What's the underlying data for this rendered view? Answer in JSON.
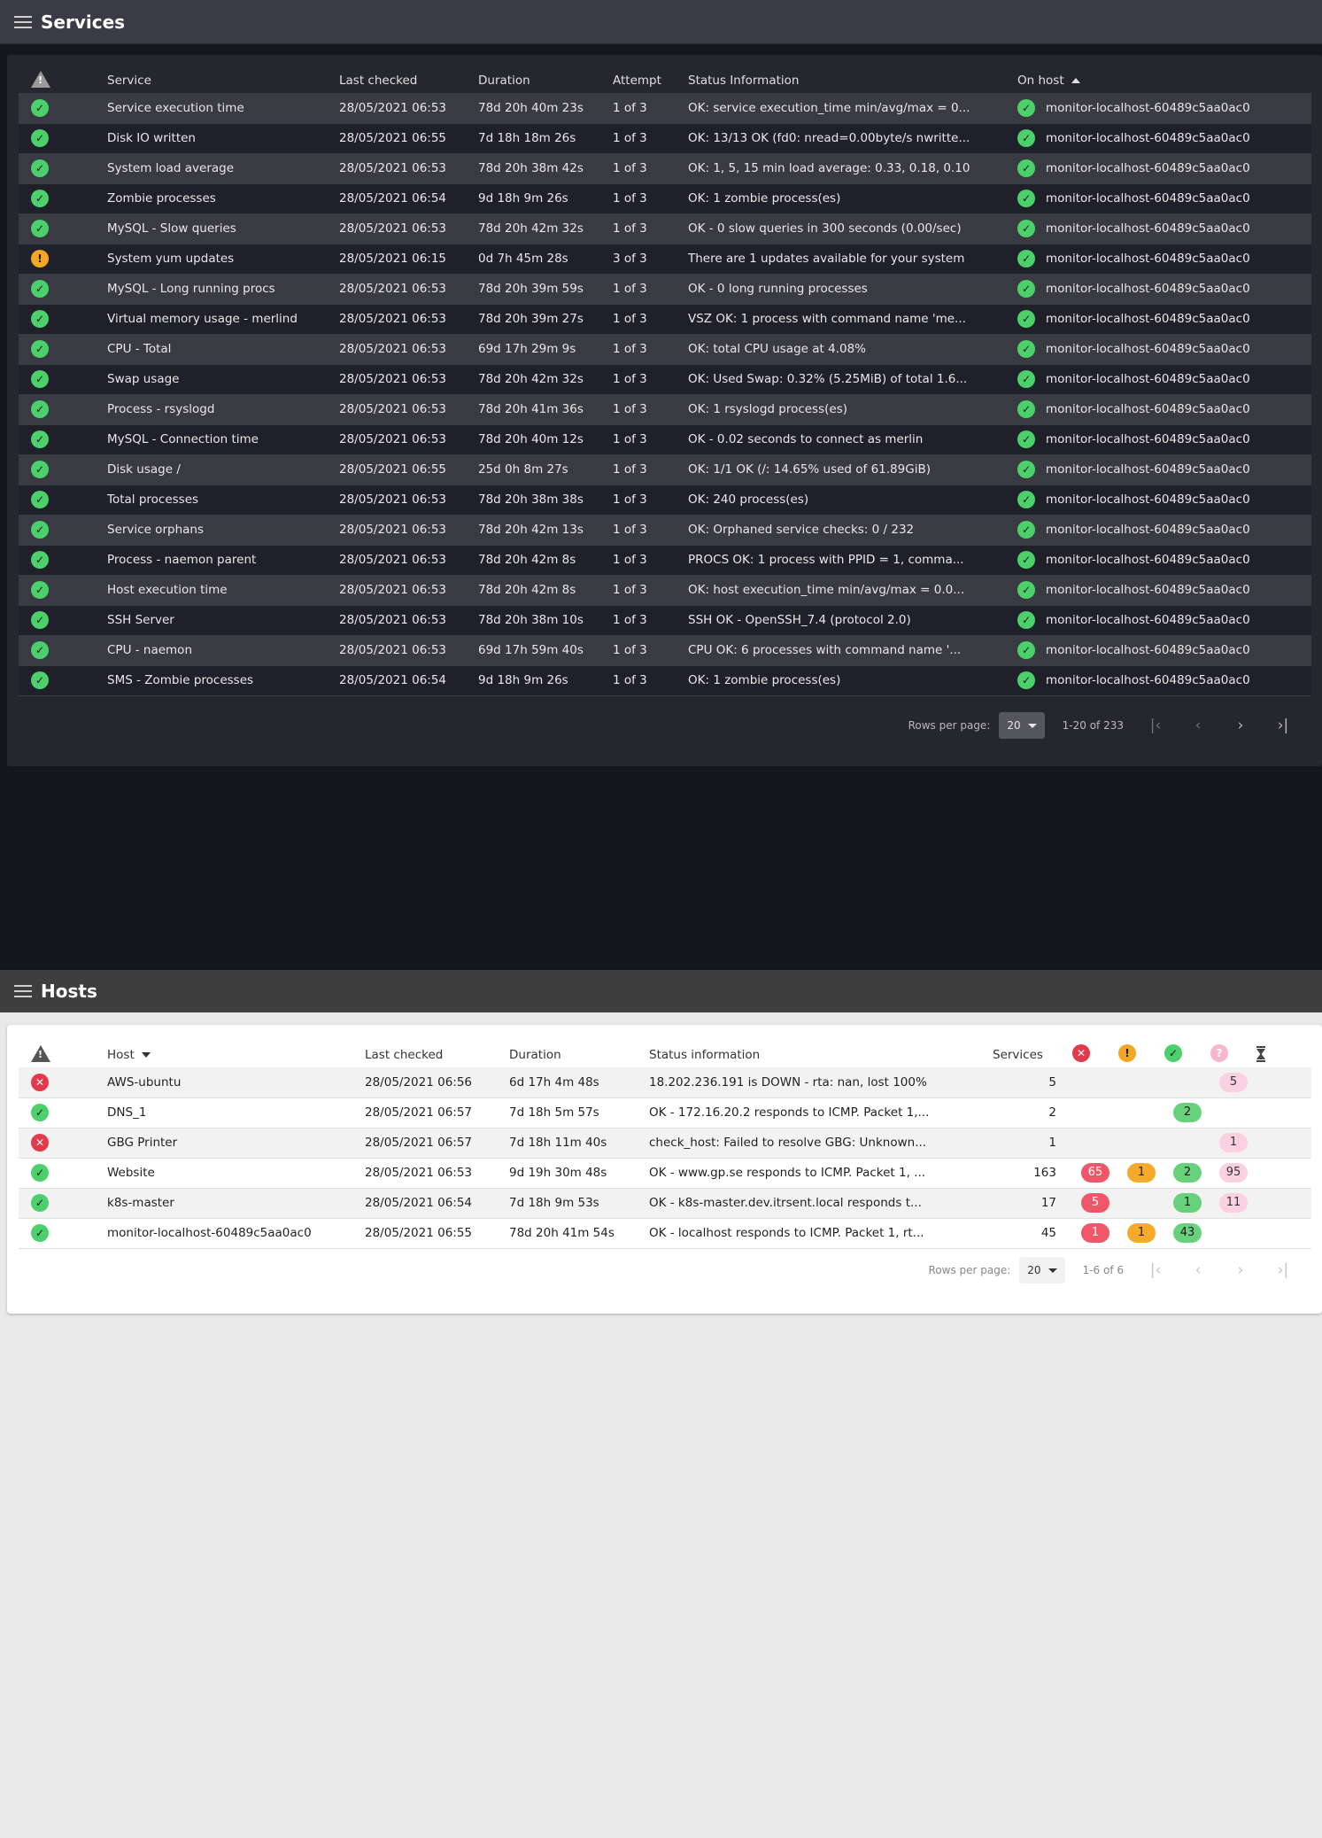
{
  "services": {
    "title": "Services",
    "columns": {
      "service": "Service",
      "last_checked": "Last checked",
      "duration": "Duration",
      "attempt": "Attempt",
      "status_info": "Status Information",
      "on_host": "On host"
    },
    "rows": [
      {
        "state": "ok",
        "service": "Service execution time",
        "last_checked": "28/05/2021 06:53",
        "duration": "78d 20h 40m 23s",
        "attempt": "1 of 3",
        "info": "OK: service execution_time min/avg/max = 0...",
        "host": "monitor-localhost-60489c5aa0ac0"
      },
      {
        "state": "ok",
        "service": "Disk IO written",
        "last_checked": "28/05/2021 06:55",
        "duration": "7d 18h 18m 26s",
        "attempt": "1 of 3",
        "info": "OK: 13/13 OK (fd0: nread=0.00byte/s nwritte...",
        "host": "monitor-localhost-60489c5aa0ac0"
      },
      {
        "state": "ok",
        "service": "System load average",
        "last_checked": "28/05/2021 06:53",
        "duration": "78d 20h 38m 42s",
        "attempt": "1 of 3",
        "info": "OK: 1, 5, 15 min load average: 0.33, 0.18, 0.10",
        "host": "monitor-localhost-60489c5aa0ac0"
      },
      {
        "state": "ok",
        "service": "Zombie processes",
        "last_checked": "28/05/2021 06:54",
        "duration": "9d 18h 9m 26s",
        "attempt": "1 of 3",
        "info": "OK: 1 zombie process(es)",
        "host": "monitor-localhost-60489c5aa0ac0"
      },
      {
        "state": "ok",
        "service": "MySQL - Slow queries",
        "last_checked": "28/05/2021 06:53",
        "duration": "78d 20h 42m 32s",
        "attempt": "1 of 3",
        "info": "OK - 0 slow queries in 300 seconds (0.00/sec)",
        "host": "monitor-localhost-60489c5aa0ac0"
      },
      {
        "state": "warn",
        "service": "System yum updates",
        "last_checked": "28/05/2021 06:15",
        "duration": "0d 7h 45m 28s",
        "attempt": "3 of 3",
        "info": "There are 1 updates available for your system",
        "host": "monitor-localhost-60489c5aa0ac0"
      },
      {
        "state": "ok",
        "service": "MySQL - Long running procs",
        "last_checked": "28/05/2021 06:53",
        "duration": "78d 20h 39m 59s",
        "attempt": "1 of 3",
        "info": "OK - 0 long running processes",
        "host": "monitor-localhost-60489c5aa0ac0"
      },
      {
        "state": "ok",
        "service": "Virtual memory usage - merlind",
        "last_checked": "28/05/2021 06:53",
        "duration": "78d 20h 39m 27s",
        "attempt": "1 of 3",
        "info": "VSZ OK: 1 process with command name 'me...",
        "host": "monitor-localhost-60489c5aa0ac0"
      },
      {
        "state": "ok",
        "service": "CPU - Total",
        "last_checked": "28/05/2021 06:53",
        "duration": "69d 17h 29m 9s",
        "attempt": "1 of 3",
        "info": "OK: total CPU usage at 4.08%",
        "host": "monitor-localhost-60489c5aa0ac0"
      },
      {
        "state": "ok",
        "service": "Swap usage",
        "last_checked": "28/05/2021 06:53",
        "duration": "78d 20h 42m 32s",
        "attempt": "1 of 3",
        "info": "OK: Used Swap: 0.32% (5.25MiB) of total 1.6...",
        "host": "monitor-localhost-60489c5aa0ac0"
      },
      {
        "state": "ok",
        "service": "Process - rsyslogd",
        "last_checked": "28/05/2021 06:53",
        "duration": "78d 20h 41m 36s",
        "attempt": "1 of 3",
        "info": "OK: 1 rsyslogd process(es)",
        "host": "monitor-localhost-60489c5aa0ac0"
      },
      {
        "state": "ok",
        "service": "MySQL - Connection time",
        "last_checked": "28/05/2021 06:53",
        "duration": "78d 20h 40m 12s",
        "attempt": "1 of 3",
        "info": "OK - 0.02 seconds to connect as merlin",
        "host": "monitor-localhost-60489c5aa0ac0"
      },
      {
        "state": "ok",
        "service": "Disk usage /",
        "last_checked": "28/05/2021 06:55",
        "duration": "25d 0h 8m 27s",
        "attempt": "1 of 3",
        "info": "OK: 1/1 OK (/: 14.65% used of 61.89GiB)",
        "host": "monitor-localhost-60489c5aa0ac0"
      },
      {
        "state": "ok",
        "service": "Total processes",
        "last_checked": "28/05/2021 06:53",
        "duration": "78d 20h 38m 38s",
        "attempt": "1 of 3",
        "info": "OK: 240 process(es)",
        "host": "monitor-localhost-60489c5aa0ac0"
      },
      {
        "state": "ok",
        "service": "Service orphans",
        "last_checked": "28/05/2021 06:53",
        "duration": "78d 20h 42m 13s",
        "attempt": "1 of 3",
        "info": "OK: Orphaned service checks: 0 / 232",
        "host": "monitor-localhost-60489c5aa0ac0"
      },
      {
        "state": "ok",
        "service": "Process - naemon parent",
        "last_checked": "28/05/2021 06:53",
        "duration": "78d 20h 42m 8s",
        "attempt": "1 of 3",
        "info": "PROCS OK: 1 process with PPID = 1, comma...",
        "host": "monitor-localhost-60489c5aa0ac0"
      },
      {
        "state": "ok",
        "service": "Host execution time",
        "last_checked": "28/05/2021 06:53",
        "duration": "78d 20h 42m 8s",
        "attempt": "1 of 3",
        "info": "OK: host execution_time min/avg/max = 0.0...",
        "host": "monitor-localhost-60489c5aa0ac0"
      },
      {
        "state": "ok",
        "service": "SSH Server",
        "last_checked": "28/05/2021 06:53",
        "duration": "78d 20h 38m 10s",
        "attempt": "1 of 3",
        "info": "SSH OK - OpenSSH_7.4 (protocol 2.0)",
        "host": "monitor-localhost-60489c5aa0ac0"
      },
      {
        "state": "ok",
        "service": "CPU - naemon",
        "last_checked": "28/05/2021 06:53",
        "duration": "69d 17h 59m 40s",
        "attempt": "1 of 3",
        "info": "CPU OK: 6 processes with command name '...",
        "host": "monitor-localhost-60489c5aa0ac0"
      },
      {
        "state": "ok",
        "service": "SMS - Zombie processes",
        "last_checked": "28/05/2021 06:54",
        "duration": "9d 18h 9m 26s",
        "attempt": "1 of 3",
        "info": "OK: 1 zombie process(es)",
        "host": "monitor-localhost-60489c5aa0ac0"
      }
    ],
    "pagination": {
      "rows_per_page_label": "Rows per page:",
      "rows_per_page": "20",
      "range": "1-20 of 233"
    }
  },
  "hosts": {
    "title": "Hosts",
    "columns": {
      "host": "Host",
      "last_checked": "Last checked",
      "duration": "Duration",
      "status_info": "Status information",
      "services": "Services"
    },
    "rows": [
      {
        "state": "crit",
        "host": "AWS-ubuntu",
        "last_checked": "28/05/2021 06:56",
        "duration": "6d 17h 4m 48s",
        "info": "18.202.236.191 is DOWN - rta: nan, lost 100%",
        "services": "5",
        "crit": "",
        "warn": "",
        "ok": "",
        "unknown": "5"
      },
      {
        "state": "ok",
        "host": "DNS_1",
        "last_checked": "28/05/2021 06:57",
        "duration": "7d 18h 5m 57s",
        "info": "OK - 172.16.20.2 responds to ICMP. Packet 1,...",
        "services": "2",
        "crit": "",
        "warn": "",
        "ok": "2",
        "unknown": ""
      },
      {
        "state": "crit",
        "host": "GBG Printer",
        "last_checked": "28/05/2021 06:57",
        "duration": "7d 18h 11m 40s",
        "info": "check_host: Failed to resolve GBG: Unknown...",
        "services": "1",
        "crit": "",
        "warn": "",
        "ok": "",
        "unknown": "1"
      },
      {
        "state": "ok",
        "host": "Website",
        "last_checked": "28/05/2021 06:53",
        "duration": "9d 19h 30m 48s",
        "info": "OK - www.gp.se responds to ICMP. Packet 1, ...",
        "services": "163",
        "crit": "65",
        "warn": "1",
        "ok": "2",
        "unknown": "95"
      },
      {
        "state": "ok",
        "host": "k8s-master",
        "last_checked": "28/05/2021 06:54",
        "duration": "7d 18h 9m 53s",
        "info": "OK - k8s-master.dev.itrsent.local responds t...",
        "services": "17",
        "crit": "5",
        "warn": "",
        "ok": "1",
        "unknown": "11"
      },
      {
        "state": "ok",
        "host": "monitor-localhost-60489c5aa0ac0",
        "last_checked": "28/05/2021 06:55",
        "duration": "78d 20h 41m 54s",
        "info": "OK - localhost responds to ICMP. Packet 1, rt...",
        "services": "45",
        "crit": "1",
        "warn": "1",
        "ok": "43",
        "unknown": ""
      }
    ],
    "pagination": {
      "rows_per_page_label": "Rows per page:",
      "rows_per_page": "20",
      "range": "1-6 of 6"
    }
  },
  "icons": {
    "ok": "check-circle-icon",
    "warn": "exclamation-circle-icon",
    "crit": "x-circle-icon",
    "unknown": "question-circle-icon",
    "pending": "hourglass-icon",
    "state": "warning-triangle-icon",
    "menu": "hamburger-menu-icon"
  },
  "colors": {
    "ok": "#4bd06b",
    "warn": "#f5a623",
    "crit": "#e23a4a",
    "unknown": "#f7b5cf",
    "dark_bg": "#16161e",
    "row_alt": "#3a3a43"
  }
}
